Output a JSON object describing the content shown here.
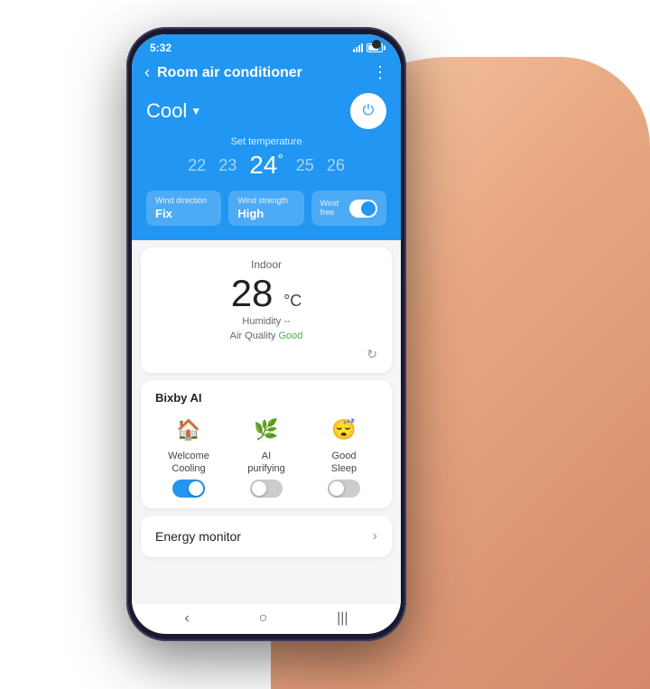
{
  "status": {
    "time": "5:32",
    "signal": [
      4,
      6,
      8,
      10,
      12
    ],
    "battery_level": "70%"
  },
  "header": {
    "back_label": "‹",
    "title": "Room air conditioner",
    "more_icon": "⋮"
  },
  "control": {
    "mode": "Cool",
    "mode_dropdown": "▼",
    "power_icon": "⏻",
    "set_temp_label": "Set temperature",
    "temps": [
      "22",
      "23",
      "24°",
      "25",
      "26"
    ],
    "wind_direction_label": "Wind direction",
    "wind_direction_value": "Fix",
    "wind_strength_label": "Wind strength",
    "wind_strength_value": "High",
    "wind_free_label": "Wind free"
  },
  "indoor": {
    "title": "Indoor",
    "temp": "28",
    "unit": "°C",
    "humidity": "Humidity --",
    "air_quality_prefix": "Air Quality ",
    "air_quality_value": "Good"
  },
  "bixby": {
    "title": "Bixby AI",
    "items": [
      {
        "icon": "🏠",
        "label": "Welcome\nCooling",
        "on": true
      },
      {
        "icon": "🌿",
        "label": "AI\npurifying",
        "on": false
      },
      {
        "icon": "😴",
        "label": "Good\nSleep",
        "on": false
      }
    ]
  },
  "energy": {
    "label": "Energy monitor",
    "chevron": "›"
  },
  "nav": {
    "back": "‹",
    "home": "○",
    "recent": "|||"
  }
}
